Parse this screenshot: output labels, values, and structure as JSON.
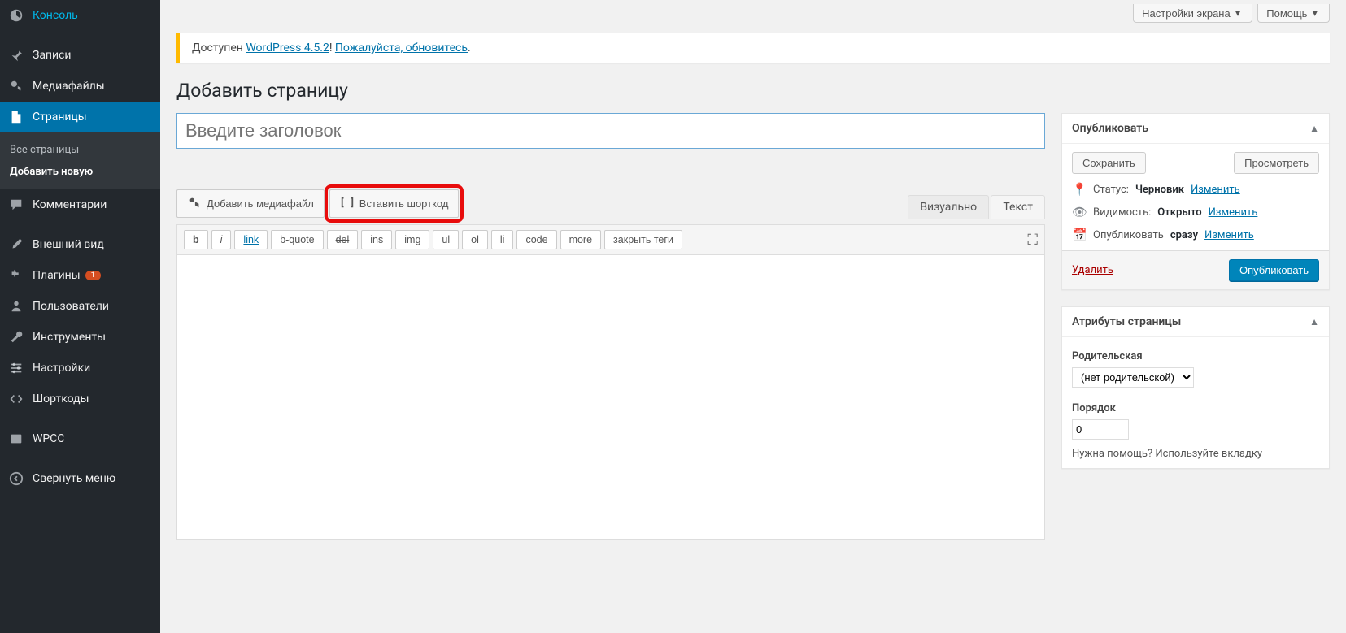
{
  "topButtons": {
    "screenOptions": "Настройки экрана",
    "help": "Помощь"
  },
  "notice": {
    "prefix": "Доступен ",
    "link1": "WordPress 4.5.2",
    "sep": "! ",
    "link2": "Пожалуйста, обновитесь",
    "suffix": "."
  },
  "pageTitle": "Добавить страницу",
  "titlePlaceholder": "Введите заголовок",
  "mediaButton": "Добавить медиафайл",
  "shortcodeButton": "Вставить шорткод",
  "editorTabs": {
    "visual": "Визуально",
    "text": "Текст"
  },
  "quicktags": [
    "b",
    "i",
    "link",
    "b-quote",
    "del",
    "ins",
    "img",
    "ul",
    "ol",
    "li",
    "code",
    "more",
    "закрыть теги"
  ],
  "sidebar": {
    "dashboard": "Консоль",
    "posts": "Записи",
    "media": "Медиафайлы",
    "pages": "Страницы",
    "allPages": "Все страницы",
    "addNew": "Добавить новую",
    "comments": "Комментарии",
    "appearance": "Внешний вид",
    "plugins": "Плагины",
    "pluginsBadge": "1",
    "users": "Пользователи",
    "tools": "Инструменты",
    "settings": "Настройки",
    "shortcodes": "Шорткоды",
    "wpcc": "WPCC",
    "collapse": "Свернуть меню"
  },
  "publishBox": {
    "title": "Опубликовать",
    "save": "Сохранить",
    "preview": "Просмотреть",
    "statusLabel": "Статус:",
    "statusValue": "Черновик",
    "visibilityLabel": "Видимость:",
    "visibilityValue": "Открыто",
    "publishLabel": "Опубликовать",
    "publishValue": "сразу",
    "edit": "Изменить",
    "delete": "Удалить",
    "publishBtn": "Опубликовать"
  },
  "attrBox": {
    "title": "Атрибуты страницы",
    "parentLabel": "Родительская",
    "parentNone": "(нет родительской)",
    "orderLabel": "Порядок",
    "orderValue": "0",
    "help": "Нужна помощь? Используйте вкладку"
  }
}
